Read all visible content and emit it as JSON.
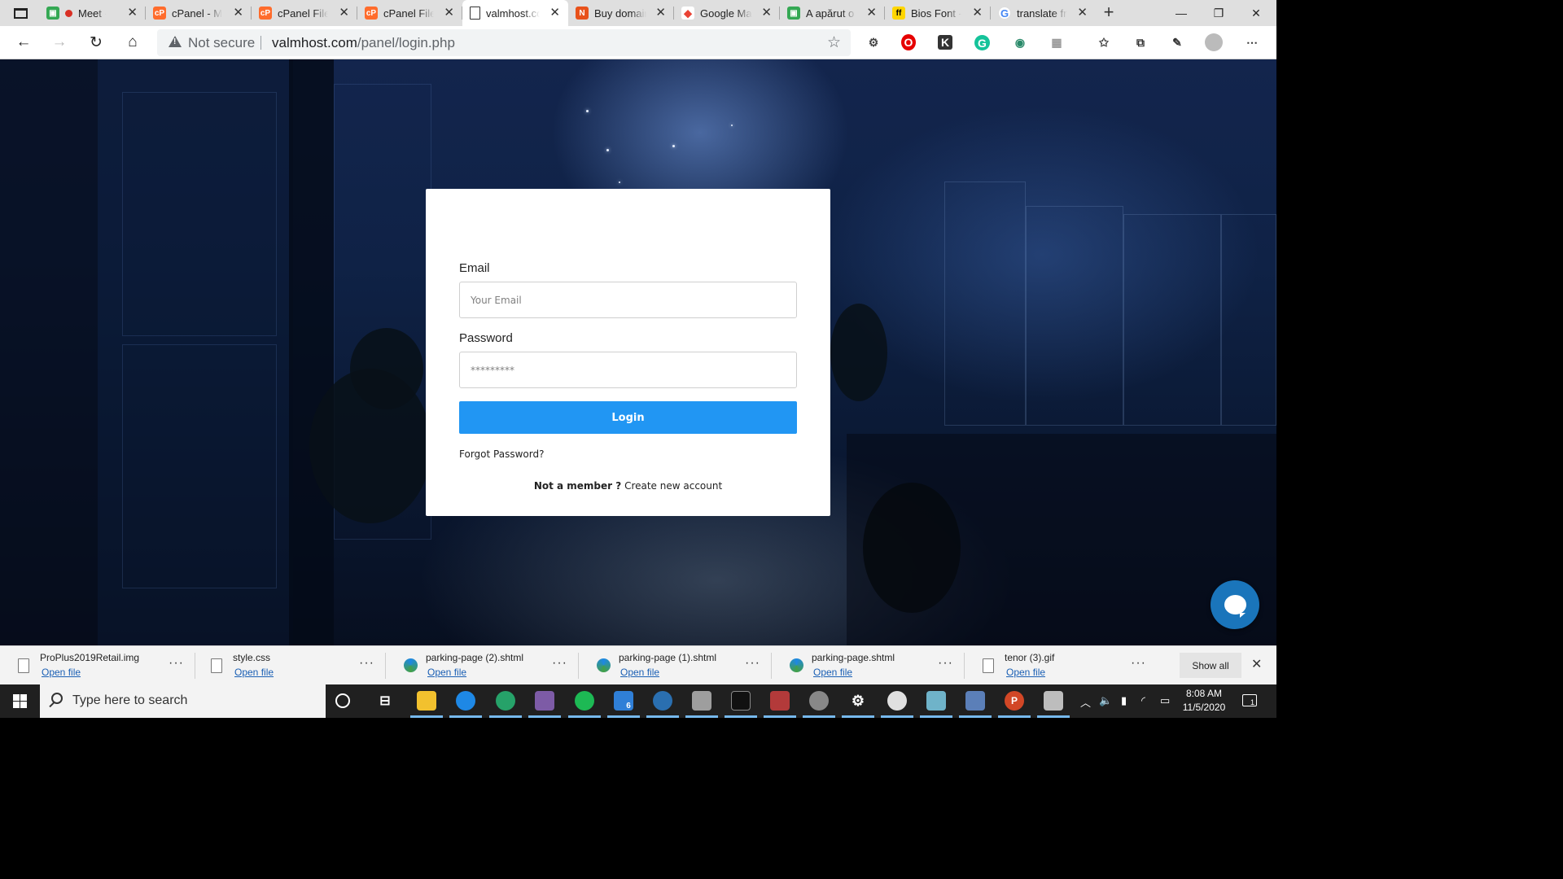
{
  "browser": {
    "tabs": [
      {
        "title": "Meet -",
        "favicon": "gmail-classroom-icon",
        "recording": true
      },
      {
        "title": "cPanel - Ma",
        "favicon": "cpanel-icon"
      },
      {
        "title": "cPanel File",
        "favicon": "cpanel-icon"
      },
      {
        "title": "cPanel File",
        "favicon": "cpanel-icon"
      },
      {
        "title": "valmhost.co",
        "favicon": "page-icon",
        "active": true
      },
      {
        "title": "Buy domain",
        "favicon": "namecheap-icon"
      },
      {
        "title": "Google Ma",
        "favicon": "google-maps-icon"
      },
      {
        "title": "A apărut o",
        "favicon": "classroom-icon"
      },
      {
        "title": "Bios Font -",
        "favicon": "fontfile-icon"
      },
      {
        "title": "translate fr",
        "favicon": "google-icon"
      }
    ],
    "address": {
      "security_label": "Not secure",
      "url_host": "valmhost.com",
      "url_path": "/panel/login.php"
    }
  },
  "login": {
    "email_label": "Email",
    "email_placeholder": "Your Email",
    "password_label": "Password",
    "password_placeholder": "*********",
    "login_button": "Login",
    "forgot_link": "Forgot Password?",
    "not_member": "Not a member ?",
    "create_account": "Create new account"
  },
  "downloads": {
    "items": [
      {
        "name": "ProPlus2019Retail.img",
        "action": "Open file",
        "icon": "disc-image-icon"
      },
      {
        "name": "style.css",
        "action": "Open file",
        "icon": "css-file-icon"
      },
      {
        "name": "parking-page (2).shtml",
        "action": "Open file",
        "icon": "edge-dev-icon"
      },
      {
        "name": "parking-page (1).shtml",
        "action": "Open file",
        "icon": "edge-dev-icon"
      },
      {
        "name": "parking-page.shtml",
        "action": "Open file",
        "icon": "edge-dev-icon"
      },
      {
        "name": "tenor (3).gif",
        "action": "Open file",
        "icon": "gif-file-icon"
      }
    ],
    "show_all": "Show all"
  },
  "taskbar": {
    "search_placeholder": "Type here to search",
    "time": "8:08 AM",
    "date": "11/5/2020",
    "mail_badge": "6",
    "notification_count": "1"
  },
  "colors": {
    "accent": "#2196f3",
    "chat": "#1a75bb"
  }
}
